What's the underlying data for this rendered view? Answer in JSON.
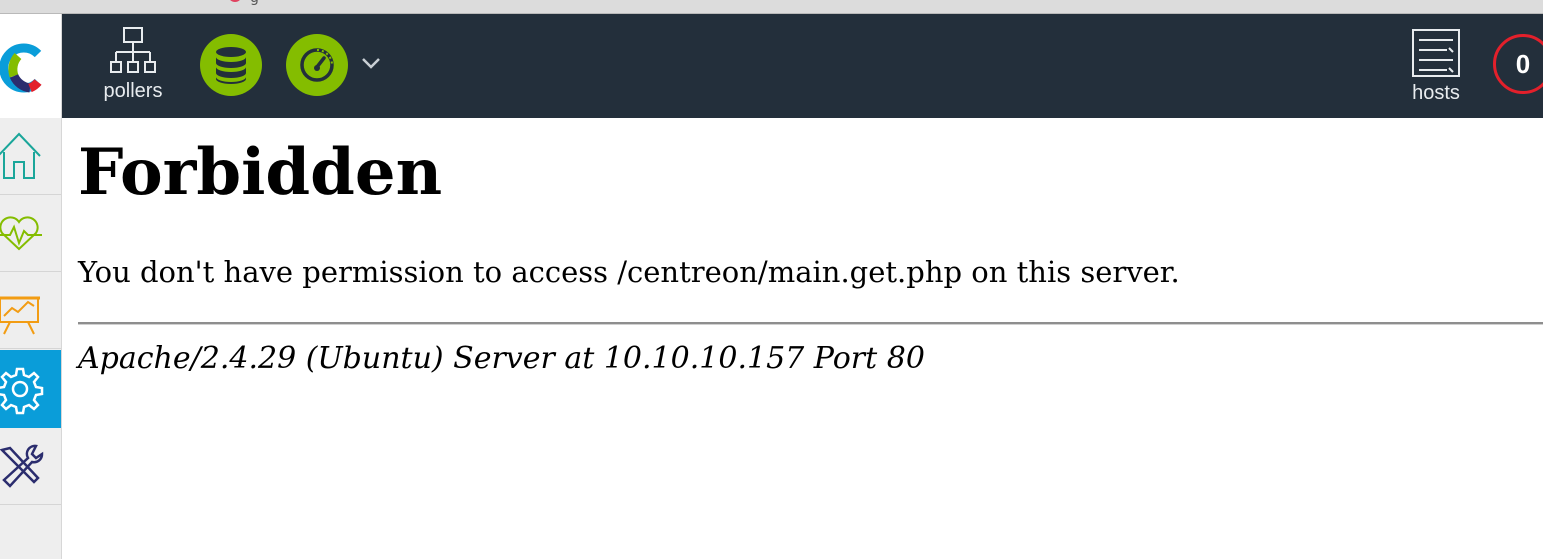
{
  "topbar": {
    "tab_text": "g"
  },
  "sidebar": {
    "logo_icon": "centreon-logo-icon",
    "items": [
      {
        "name": "home",
        "icon": "home-icon",
        "color": "#1aa69a",
        "active": false
      },
      {
        "name": "monitoring",
        "icon": "heartbeat-icon",
        "color": "#84bd00",
        "active": false
      },
      {
        "name": "reporting",
        "icon": "chart-board-icon",
        "color": "#f29c13",
        "active": true
      },
      {
        "name": "configuration",
        "icon": "gear-icon",
        "color": "#ffffff",
        "active": true
      },
      {
        "name": "administration",
        "icon": "tools-icon",
        "color": "#2b2d6e",
        "active": false
      }
    ]
  },
  "navbar": {
    "pollers_label": "pollers",
    "database_icon": "database-icon",
    "engine_icon": "gauge-icon",
    "dropdown_icon": "chevron-down-icon",
    "hosts_label": "hosts",
    "hosts_down_count": "0",
    "colors": {
      "background": "#232f3b",
      "green": "#84bd00",
      "red": "#e3202b"
    }
  },
  "error_page": {
    "title": "Forbidden",
    "message": "You don't have permission to access /centreon/main.get.php on this server.",
    "server_signature": "Apache/2.4.29 (Ubuntu) Server at 10.10.10.157 Port 80"
  }
}
